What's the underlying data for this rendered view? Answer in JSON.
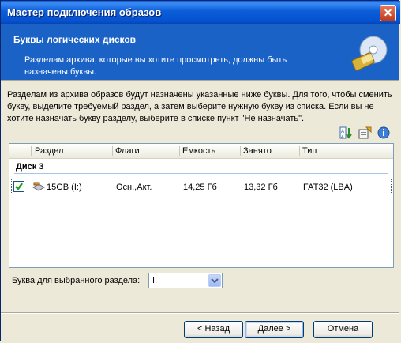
{
  "window": {
    "title": "Мастер подключения образов",
    "close_glyph": "✕"
  },
  "banner": {
    "title": "Буквы логических дисков",
    "description": "Разделам архива, которые вы хотите просмотреть, должны быть назначены буквы.",
    "icon": "disk-wizard-icon"
  },
  "instructions": "Разделам из архива образов будут назначены указанные ниже буквы. Для того, чтобы сменить букву, выделите требуемый раздел, а затем выберите нужную букву из списка. Если вы не хотите назначать букву разделу, выберите в списке пункт \"Не назначать\".",
  "toolbar": {
    "icons": [
      "sort-icon",
      "properties-icon",
      "info-icon"
    ]
  },
  "table": {
    "columns": [
      "Раздел",
      "Флаги",
      "Емкость",
      "Занято",
      "Тип"
    ],
    "group": "Диск 3",
    "rows": [
      {
        "checked": true,
        "partition": "15GB (I:)",
        "flags": "Осн.,Акт.",
        "capacity": "14,25 Гб",
        "used": "13,32 Гб",
        "type": "FAT32 (LBA)"
      }
    ]
  },
  "drive_letter": {
    "label": "Буква для выбранного раздела:",
    "value": "I:"
  },
  "buttons": {
    "back": "< Назад",
    "next": "Далее >",
    "cancel": "Отмена"
  },
  "colors": {
    "banner": "#1B62C6",
    "titlebar": "#0B5ED8",
    "face": "#ECE9D8"
  }
}
